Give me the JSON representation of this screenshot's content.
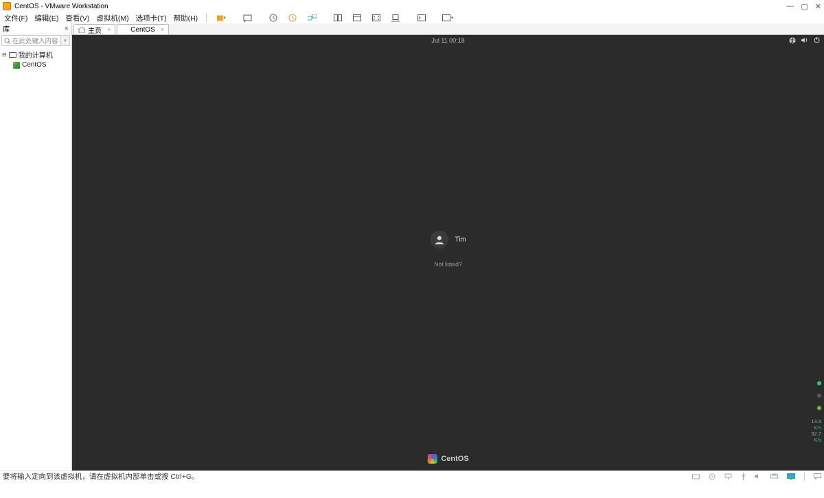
{
  "window": {
    "title": "CentOS - VMware Workstation"
  },
  "menu": {
    "file": "文件(F)",
    "edit": "编辑(E)",
    "view": "查看(V)",
    "vm": "虚拟机(M)",
    "tabs": "选项卡(T)",
    "help": "帮助(H)"
  },
  "library": {
    "title": "库",
    "search_placeholder": "在此处键入内容…",
    "root": "我的计算机",
    "vm": "CentOS"
  },
  "tabs": {
    "home": "主页",
    "active": "CentOS"
  },
  "guest": {
    "datetime": "Jul 11  00:18",
    "user": "Tim",
    "not_listed": "Not listed?",
    "brand": "CentOS",
    "perf": {
      "p1": "13.8",
      "u1": "K/s",
      "p2": "32.7",
      "u2": "K/s"
    }
  },
  "status": {
    "hint": "要将输入定向到该虚拟机，请在虚拟机内部单击或按 Ctrl+G。"
  }
}
